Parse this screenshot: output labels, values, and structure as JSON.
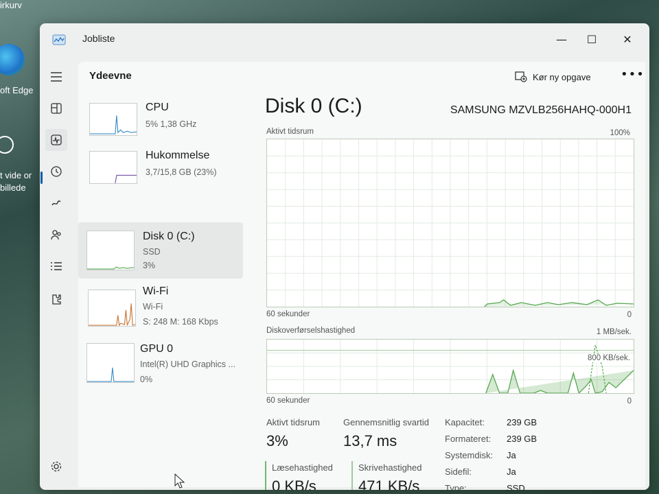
{
  "desktop": {
    "texts": [
      "irkurv",
      "oft Edge",
      "t vide or",
      "billede"
    ]
  },
  "window": {
    "title": "Jobliste",
    "controls": {
      "minimize": "—",
      "maximize": "☐",
      "close": "✕"
    }
  },
  "panel": {
    "title": "Ydeevne",
    "new_task_label": "Kør ny opgave",
    "more": "•••"
  },
  "resources": [
    {
      "name": "CPU",
      "sub1": "5%  1,38 GHz",
      "sub2": "",
      "color": "#3a8fc8"
    },
    {
      "name": "Hukommelse",
      "sub1": "3,7/15,8 GB (23%)",
      "sub2": "",
      "color": "#7a5aa8"
    },
    {
      "name": "Disk 0 (C:)",
      "sub1": "SSD",
      "sub2": "3%",
      "color": "#56a84f"
    },
    {
      "name": "Wi-Fi",
      "sub1": "Wi-Fi",
      "sub2": "S: 248  M: 168 Kbps",
      "color": "#c87a3a"
    },
    {
      "name": "GPU 0",
      "sub1": "Intel(R) UHD Graphics ...",
      "sub2": "0%",
      "color": "#3a8fc8"
    }
  ],
  "detail": {
    "title": "Disk 0 (C:)",
    "model": "SAMSUNG MZVLB256HAHQ-000H1",
    "graph1": {
      "label": "Aktivt tidsrum",
      "max": "100%",
      "time": "60 sekunder",
      "min": "0"
    },
    "graph2": {
      "label": "Diskoverførselshastighed",
      "max": "1 MB/sek.",
      "mid": "800 KB/sek.",
      "time": "60 sekunder",
      "min": "0"
    },
    "stats": {
      "active_label": "Aktivt tidsrum",
      "active_value": "3%",
      "response_label": "Gennemsnitlig svartid",
      "response_value": "13,7 ms",
      "read_label": "Læsehastighed",
      "read_value": "0 KB/s",
      "write_label": "Skrivehastighed",
      "write_value": "471 KB/s"
    },
    "properties": [
      {
        "label": "Kapacitet:",
        "value": "239 GB"
      },
      {
        "label": "Formateret:",
        "value": "239 GB"
      },
      {
        "label": "Systemdisk:",
        "value": "Ja"
      },
      {
        "label": "Sidefil:",
        "value": "Ja"
      },
      {
        "label": "Type:",
        "value": "SSD"
      }
    ]
  },
  "accent_color": "#0b5cab",
  "disk_color": "#56a84f"
}
